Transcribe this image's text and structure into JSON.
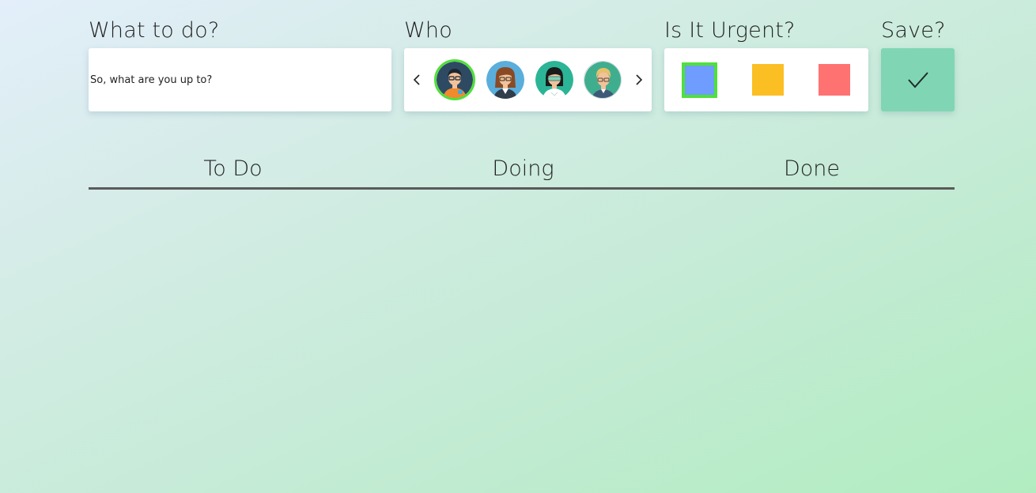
{
  "labels": {
    "task": "What to do?",
    "who": "Who",
    "urgency": "Is It Urgent?",
    "save": "Save?"
  },
  "task_input": {
    "value": "",
    "placeholder": "So, what are you up to?"
  },
  "who": {
    "prev_icon": "chevron-left-icon",
    "next_icon": "chevron-right-icon",
    "avatars": [
      {
        "name": "avatar-man-glasses",
        "selected": true
      },
      {
        "name": "avatar-woman-brown-hair",
        "selected": false
      },
      {
        "name": "avatar-woman-headset",
        "selected": false
      },
      {
        "name": "avatar-man-blond",
        "selected": false
      }
    ],
    "colors": {
      "selected_border": "#4fe03a"
    }
  },
  "urgency": {
    "options": [
      {
        "name": "low",
        "color": "#6e9cff",
        "selected": true
      },
      {
        "name": "medium",
        "color": "#fbbf24",
        "selected": false
      },
      {
        "name": "high",
        "color": "#ff7272",
        "selected": false
      }
    ]
  },
  "save": {
    "icon": "checkmark-icon",
    "color": "#80d6b4"
  },
  "columns": [
    "To Do",
    "Doing",
    "Done"
  ],
  "colors": {
    "accent_green": "#4fe03a",
    "divider": "#5a5a5a"
  }
}
